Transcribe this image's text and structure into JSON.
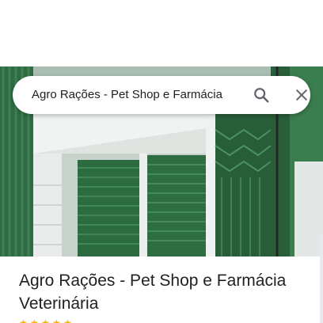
{
  "search": {
    "query": "Agro Rações - Pet Shop e Farmácia",
    "search_icon": "search-icon",
    "close_icon": "close-icon"
  },
  "place": {
    "title": "Agro Rações - Pet Shop e Farmácia Veterinária",
    "rating_stars_visible": 5,
    "star_color": "#f4b400"
  },
  "photo": {
    "subject": "storefront-photo",
    "dominant_color": "#2f6b43"
  }
}
